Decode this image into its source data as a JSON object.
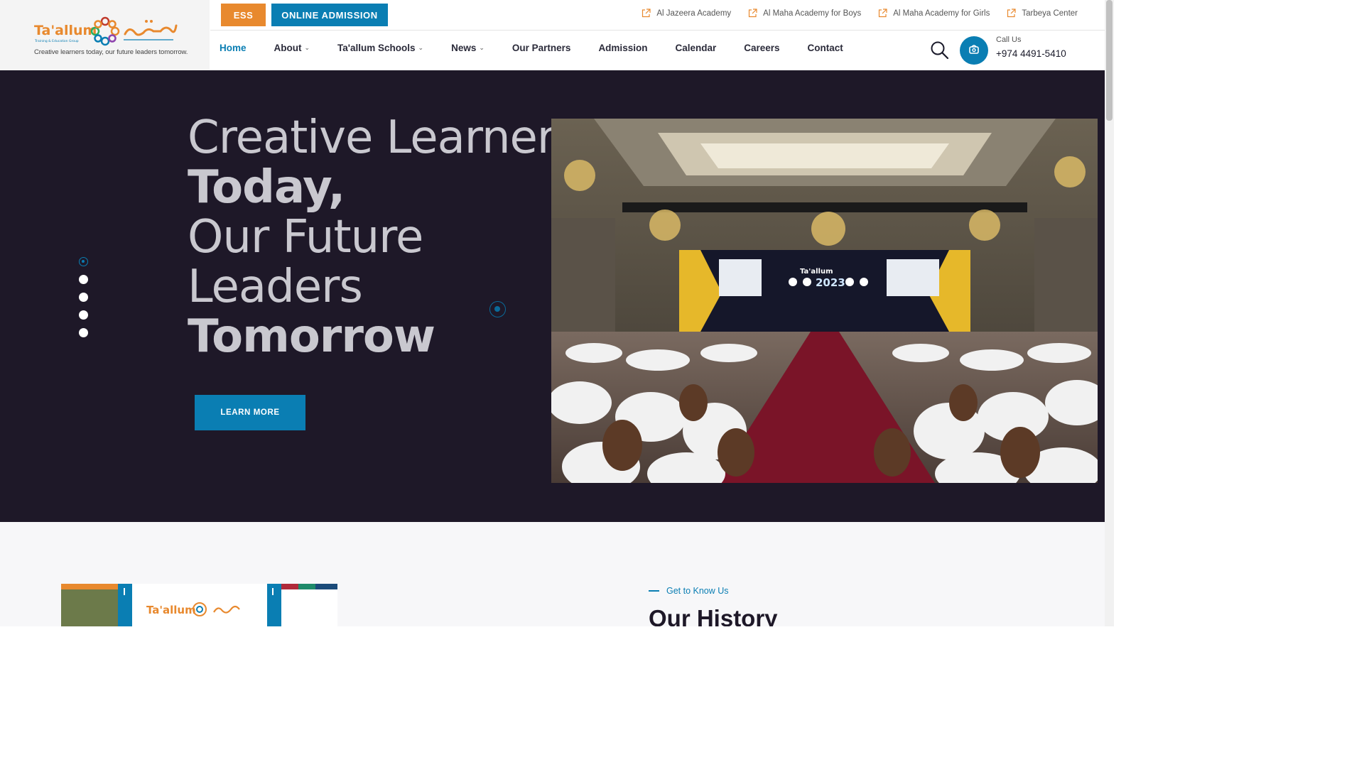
{
  "logo": {
    "en": "Ta'allum",
    "sub": "Training & Education Group",
    "tagline": "Creative learners today, our future leaders tomorrow."
  },
  "top_buttons": {
    "ess": "ESS",
    "admission": "ONLINE ADMISSION"
  },
  "top_links": [
    "Al Jazeera Academy",
    "Al Maha Academy for Boys",
    "Al Maha Academy for Girls",
    "Tarbeya Center"
  ],
  "nav": [
    {
      "label": "Home",
      "active": true,
      "dropdown": false
    },
    {
      "label": "About",
      "dropdown": true
    },
    {
      "label": "Ta'allum Schools",
      "dropdown": true
    },
    {
      "label": "News",
      "dropdown": true
    },
    {
      "label": "Our Partners",
      "dropdown": false
    },
    {
      "label": "Admission",
      "dropdown": false
    },
    {
      "label": "Calendar",
      "dropdown": false
    },
    {
      "label": "Careers",
      "dropdown": false
    },
    {
      "label": "Contact",
      "dropdown": false
    }
  ],
  "call": {
    "label": "Call Us",
    "number": "+974 4491-5410"
  },
  "hero": {
    "line1": "Creative Learners",
    "line2": "Today,",
    "line3": "Our Future",
    "line4": "Leaders",
    "line5": "Tomorrow",
    "button": "LEARN MORE",
    "photo_stage": "2023",
    "slides": 5,
    "active_slide": 1
  },
  "lower": {
    "kicker": "Get to Know Us",
    "heading": "Our History"
  },
  "colors": {
    "brand_blue": "#0a7eb3",
    "brand_orange": "#e8892e",
    "hero_bg": "#1e1828"
  }
}
